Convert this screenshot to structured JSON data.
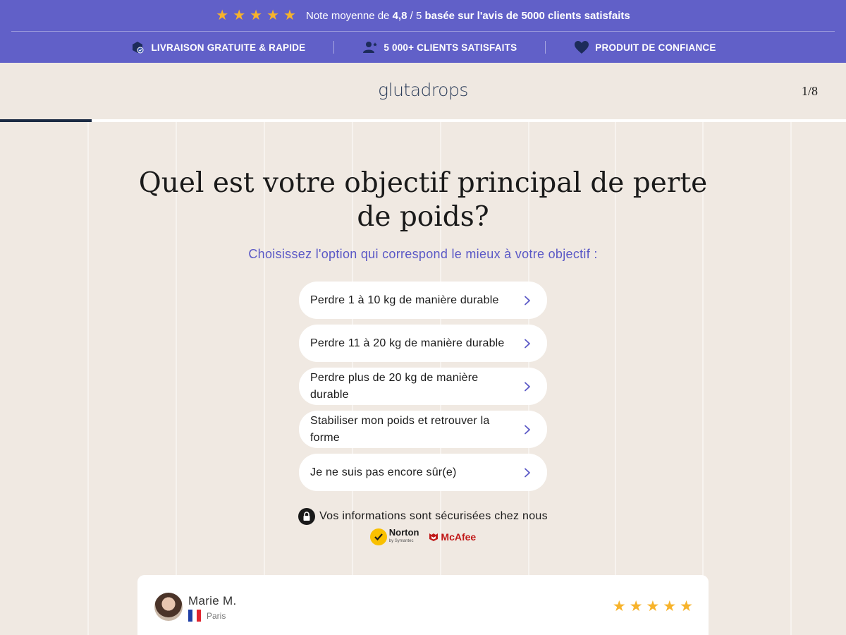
{
  "topbar": {
    "rating_stars": 5,
    "rating_prefix": "Note moyenne de",
    "rating_value": "4,8",
    "rating_sep": "/ 5",
    "rating_suffix": "basée sur l'avis de 5000 clients satisfaits",
    "features": [
      {
        "icon": "delivery-box-icon",
        "label": "LIVRAISON GRATUITE & RAPIDE"
      },
      {
        "icon": "users-icon",
        "label": "5 000+ CLIENTS SATISFAITS"
      },
      {
        "icon": "heart-icon",
        "label": "PRODUIT DE CONFIANCE"
      }
    ],
    "background": "#6160c8",
    "star_color": "#f7b32b"
  },
  "header": {
    "logo": "glutadrops",
    "step": "1/8",
    "progress": 0.108
  },
  "main": {
    "question": "Quel est votre objectif principal de perte de poids?",
    "subtitle": "Choisissez l'option qui correspond le mieux à votre objectif :",
    "options": [
      {
        "label": "Perdre 1 à 10 kg de manière durable"
      },
      {
        "label": "Perdre 11 à 20 kg de manière durable"
      },
      {
        "label": "Perdre plus de 20 kg de manière durable"
      },
      {
        "label": "Stabiliser mon poids et retrouver la forme"
      },
      {
        "label": "Je ne suis pas encore sûr(e)"
      }
    ],
    "secure_text": "Vos informations sont sécurisées chez nous",
    "badges": {
      "norton": "Norton",
      "norton_sub": "by Symantec",
      "mcafee": "McAfee"
    },
    "accent_color": "#5a58c6"
  },
  "review": {
    "name": "Marie M.",
    "city": "Paris",
    "stars": 5
  }
}
